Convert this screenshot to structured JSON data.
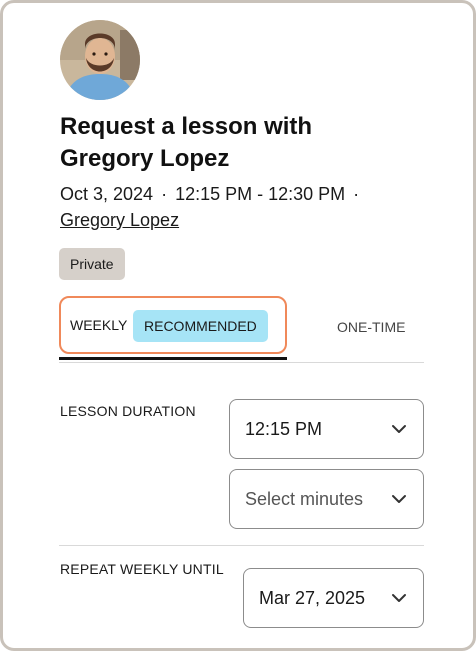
{
  "header": {
    "title": "Request a lesson with Gregory Lopez",
    "date": "Oct 3, 2024",
    "time_range": "12:15 PM - 12:30 PM",
    "separator": "·",
    "instructor_link": "Gregory Lopez",
    "badge": "Private"
  },
  "tabs": {
    "weekly": "WEEKLY",
    "recommended": "RECOMMENDED",
    "one_time": "ONE-TIME"
  },
  "form": {
    "duration_label": "LESSON DURATION",
    "start_time": "12:15 PM",
    "minutes_placeholder": "Select minutes",
    "repeat_label": "REPEAT WEEKLY UNTIL",
    "repeat_until": "Mar 27, 2025"
  },
  "colors": {
    "tab_highlight_border": "#f0895a",
    "recommended_badge": "#a6e4f6",
    "private_badge": "#d6d0ca"
  }
}
